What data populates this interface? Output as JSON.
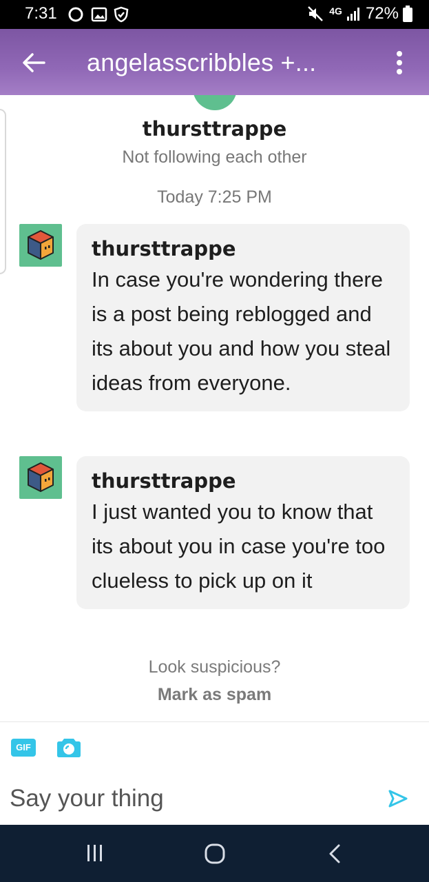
{
  "status_bar": {
    "time": "7:31",
    "network": "4G",
    "battery": "72%",
    "icons": [
      "circle-icon",
      "image-icon",
      "shield-icon",
      "mute-icon",
      "signal-icon",
      "battery-icon"
    ]
  },
  "header": {
    "title": "angelasscribbles +...",
    "background_color": "#8a62b0",
    "icons": [
      "back-arrow-icon",
      "more-vertical-icon"
    ]
  },
  "conversation": {
    "peer_name": "thursttrappe",
    "peer_status": "Not following each other",
    "timestamp": "Today 7:25 PM",
    "messages": [
      {
        "sender": "thursttrappe",
        "text": "In case you're wondering there is a post being reblogged and its about you and how you steal ideas from everyone."
      },
      {
        "sender": "thursttrappe",
        "text": "I just wanted you to know that its about you in case you're too clueless to pick up on it"
      }
    ],
    "spam_prompt": "Look suspicious?",
    "spam_action": "Mark as spam"
  },
  "composer": {
    "gif_label": "GIF",
    "placeholder": "Say your thing",
    "accent_color": "#34c5e8",
    "icons": [
      "gif-icon",
      "camera-icon",
      "send-icon"
    ]
  },
  "nav_bar": {
    "icons": [
      "recents-icon",
      "home-icon",
      "back-icon"
    ]
  }
}
